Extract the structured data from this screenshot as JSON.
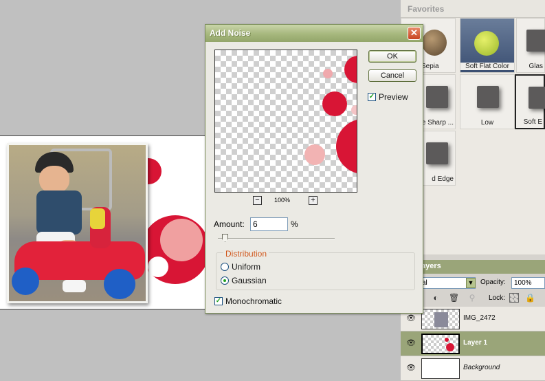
{
  "dialog": {
    "title": "Add Noise",
    "close_glyph": "✕",
    "ok_label": "OK",
    "cancel_label": "Cancel",
    "preview_label": "Preview",
    "preview_checked": true,
    "zoom_out_glyph": "−",
    "zoom_in_glyph": "+",
    "zoom_level": "100%",
    "amount_label": "Amount:",
    "amount_value": "6",
    "amount_unit": "%",
    "amount_slider_fraction": 0.06,
    "distribution_label": "Distribution",
    "uniform_label": "Uniform",
    "gaussian_label": "Gaussian",
    "selected_distribution": "Gaussian",
    "monochromatic_label": "Monochromatic",
    "monochromatic_checked": true
  },
  "favorites": {
    "title": "Favorites",
    "items": [
      {
        "label": "t Sepia"
      },
      {
        "label": "Soft Flat Color"
      },
      {
        "label": "Glas"
      },
      {
        "label": "e Sharp ..."
      },
      {
        "label": "Low"
      },
      {
        "label": "Soft E"
      },
      {
        "label": "d Edge"
      }
    ]
  },
  "layers": {
    "title": "ayers",
    "blend_mode": "al",
    "opacity_label": "Opacity:",
    "opacity_value": "100%",
    "lock_label": "Lock:",
    "items": [
      {
        "name": "IMG_2472"
      },
      {
        "name": "Layer 1"
      },
      {
        "name": "Background"
      }
    ]
  },
  "colors": {
    "dialog_title_bar": "#9fb075",
    "layer_selected": "#9aa579",
    "red_circle": "#d81535",
    "distribution_label": "#d0561b"
  }
}
